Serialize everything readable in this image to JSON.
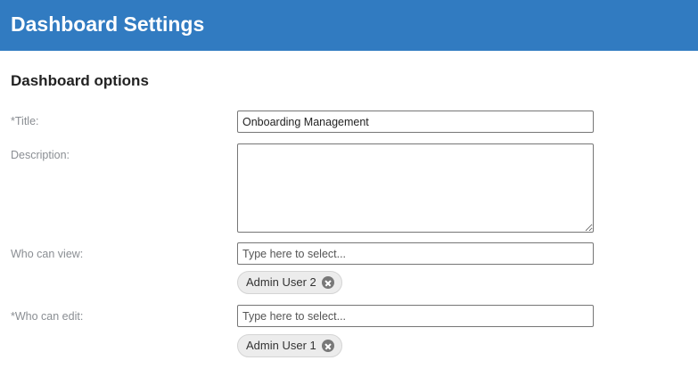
{
  "header": {
    "title": "Dashboard Settings"
  },
  "section": {
    "title": "Dashboard options"
  },
  "fields": {
    "title": {
      "label": "*Title:",
      "value": "Onboarding Management"
    },
    "description": {
      "label": "Description:",
      "value": ""
    },
    "who_can_view": {
      "label": "Who can view:",
      "placeholder": "Type here to select...",
      "selected": [
        "Admin User 2"
      ]
    },
    "who_can_edit": {
      "label": "*Who can edit:",
      "placeholder": "Type here to select...",
      "selected": [
        "Admin User 1"
      ]
    }
  },
  "colors": {
    "header_background": "#317bc1",
    "label_text": "#8a8e93",
    "chip_background": "#ececec"
  },
  "icons": {
    "chip_remove": "remove-circle-x-icon"
  }
}
